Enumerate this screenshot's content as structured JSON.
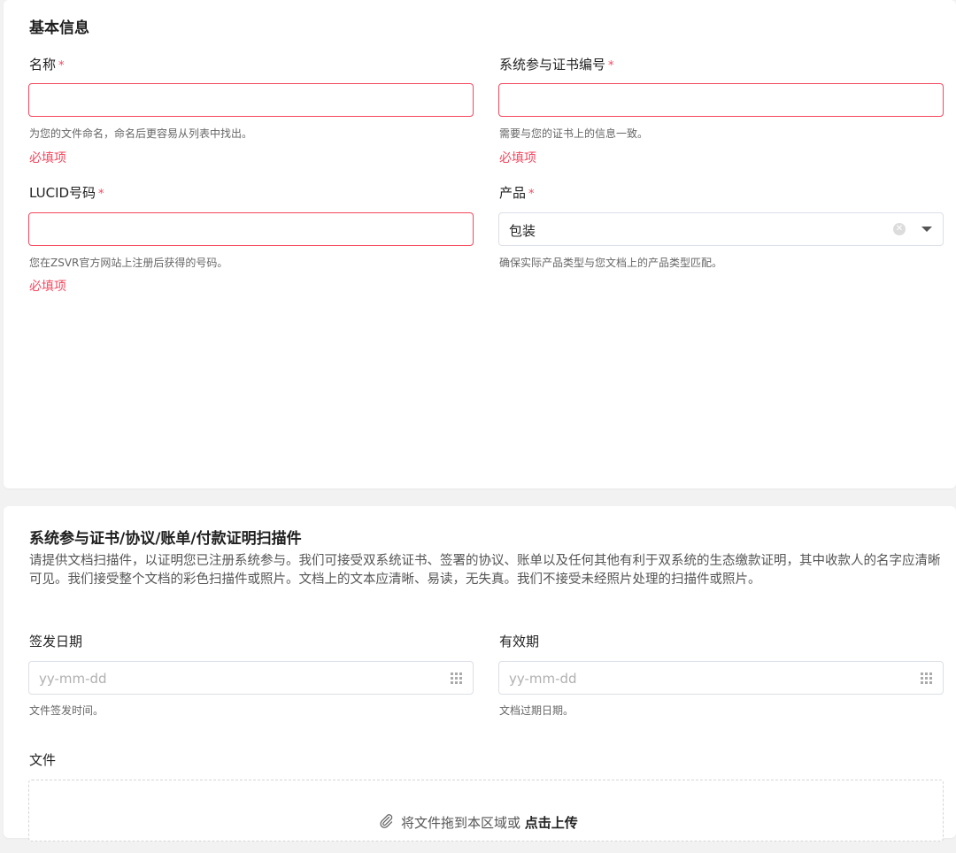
{
  "basic": {
    "title": "基本信息",
    "name_label": "名称",
    "name_help": "为您的文件命名，命名后更容易从列表中找出。",
    "cert_label": "系统参与证书编号",
    "cert_help": "需要与您的证书上的信息一致。",
    "lucid_label": "LUCID号码",
    "lucid_help": "您在ZSVR官方网站上注册后获得的号码。",
    "product_label": "产品",
    "product_value": "包装",
    "product_help": "确保实际产品类型与您文档上的产品类型匹配。",
    "required_mark": "*",
    "required_error": "必填项"
  },
  "scan": {
    "title": "系统参与证书/协议/账单/付款证明扫描件",
    "description": "请提供文档扫描件，以证明您已注册系统参与。我们可接受双系统证书、签署的协议、账单以及任何其他有利于双系统的生态缴款证明，其中收款人的名字应清晰可见。我们接受整个文档的彩色扫描件或照片。文档上的文本应清晰、易读，无失真。我们不接受未经照片处理的扫描件或照片。",
    "issue_label": "签发日期",
    "issue_placeholder": "yy-mm-dd",
    "issue_help": "文件签发时间。",
    "expiry_label": "有效期",
    "expiry_placeholder": "yy-mm-dd",
    "expiry_help": "文档过期日期。",
    "file_label": "文件",
    "drop_text": "将文件拖到本区域或",
    "drop_link": "点击上传"
  },
  "colors": {
    "required": "#f5475e",
    "background": "#f2f2f3"
  },
  "icons": {
    "clear": "clear-icon",
    "caret": "caret-down-icon",
    "calendar": "calendar-grid-icon",
    "attachment": "paperclip-icon"
  }
}
